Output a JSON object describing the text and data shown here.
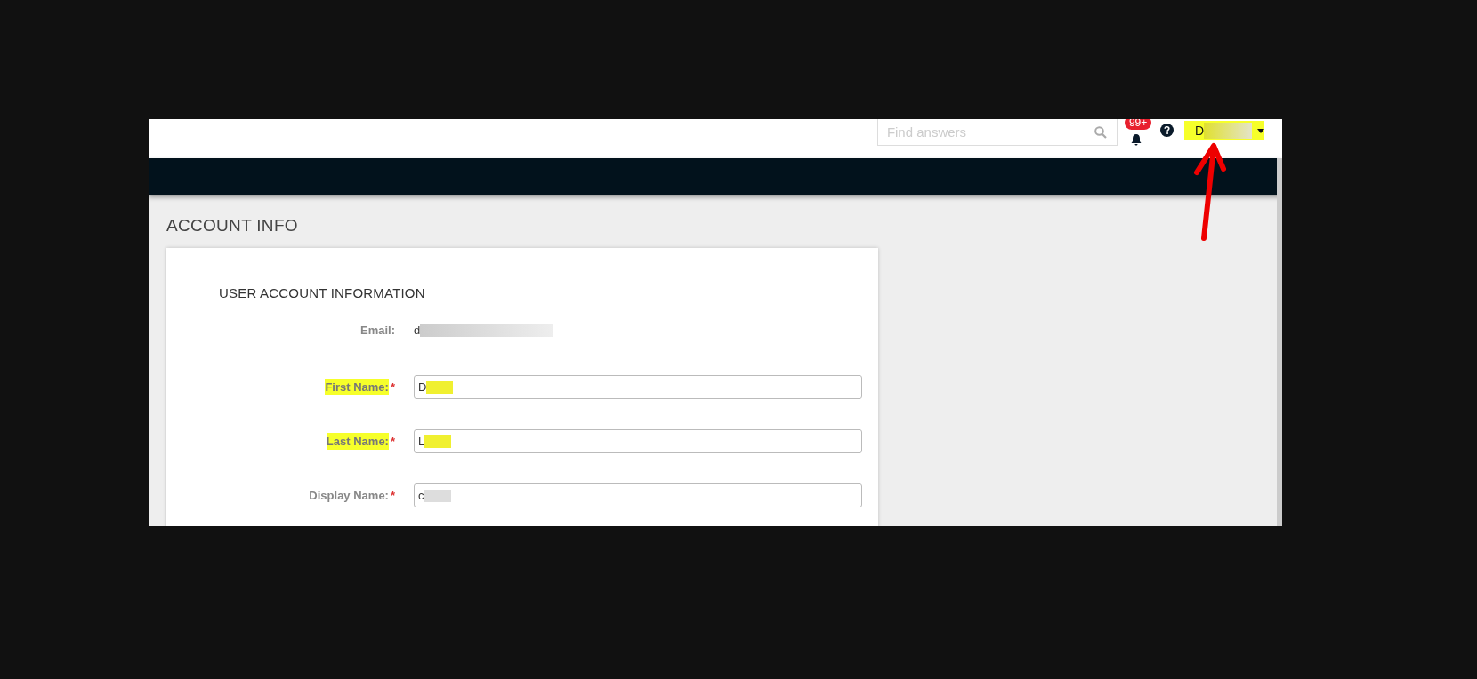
{
  "header": {
    "search": {
      "placeholder": "Find answers"
    },
    "notifications": {
      "badge": "99+"
    },
    "user": {
      "name": "D",
      "redacted": true,
      "highlighted": true
    }
  },
  "page": {
    "title": "ACCOUNT INFO"
  },
  "card": {
    "title": "USER ACCOUNT INFORMATION",
    "fields": [
      {
        "kind": "static",
        "label": "Email:",
        "highlighted": false,
        "value": "d",
        "redacted": true
      },
      {
        "kind": "input",
        "label": "First Name:",
        "required_mark": "*",
        "highlighted": true,
        "value": "D",
        "redacted": true
      },
      {
        "kind": "input",
        "label": "Last Name:",
        "required_mark": "*",
        "highlighted": true,
        "value": "L",
        "redacted": true
      },
      {
        "kind": "input",
        "label": "Display Name:",
        "required_mark": "*",
        "highlighted": false,
        "value": "c",
        "redacted": true
      }
    ]
  },
  "annotations": [
    {
      "kind": "arrow"
    }
  ]
}
